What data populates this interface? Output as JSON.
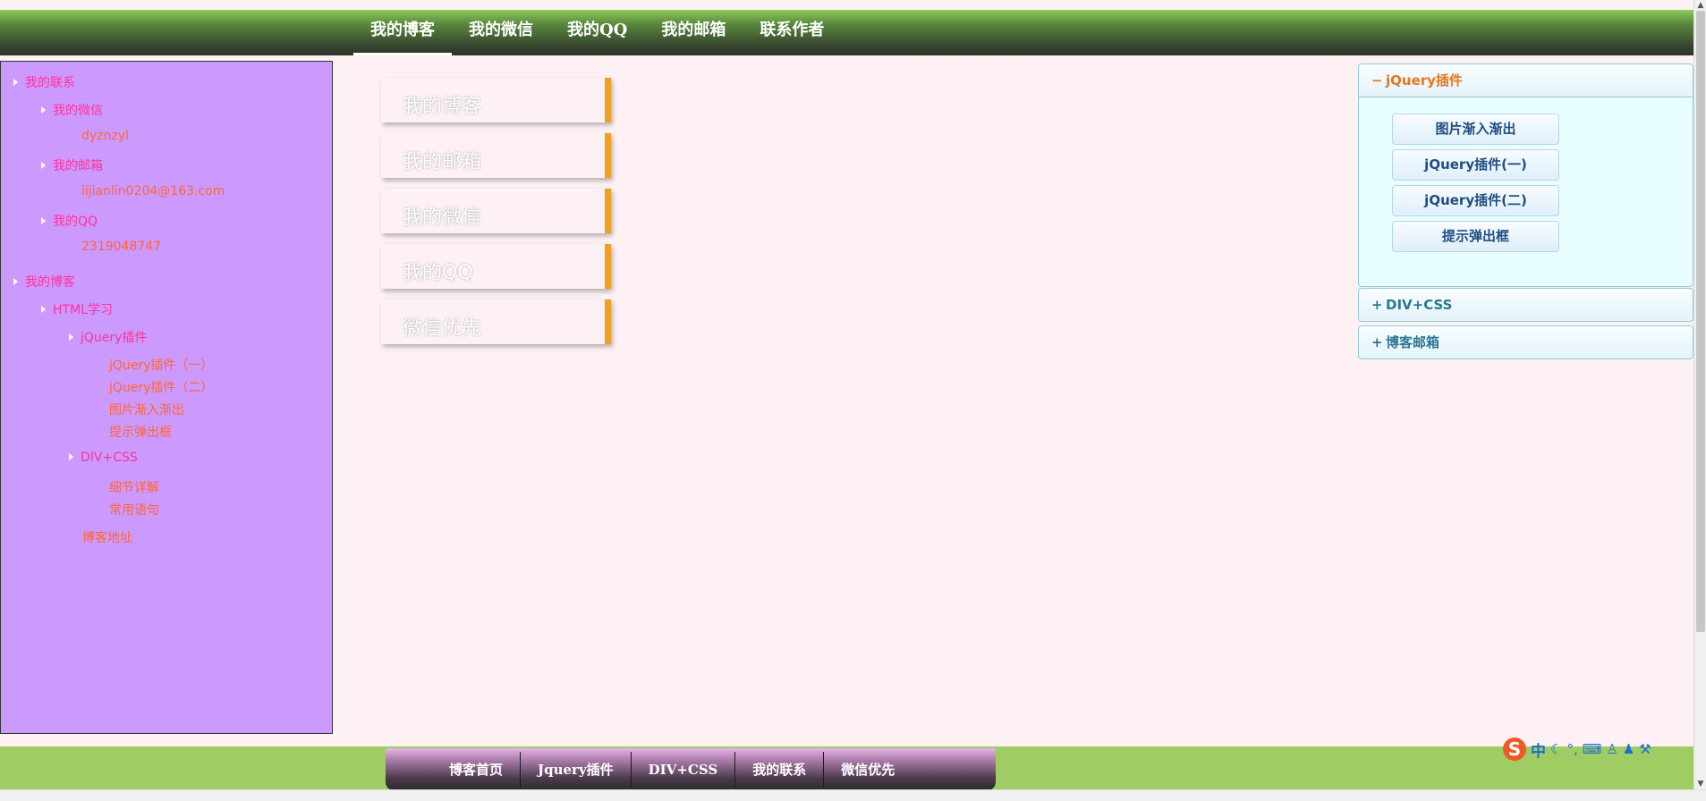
{
  "top_nav": {
    "items": [
      "我的博客",
      "我的微信",
      "我的QQ",
      "我的邮箱",
      "联系作者"
    ]
  },
  "left_tree": {
    "contact": "我的联系",
    "wechat": "我的微信",
    "wechat_value": "dyznzyl",
    "email": "我的邮箱",
    "email_value": "lijianlin0204@163.com",
    "qq": "我的QQ",
    "qq_value": "2319048747",
    "blog": "我的博客",
    "html": "HTML学习",
    "jquery": "jQuery插件",
    "jquery_one": "jQuery插件（一）",
    "jquery_two": "jQuery插件（二）",
    "fade": "图片渐入渐出",
    "popup": "提示弹出框",
    "divcss": "DIV+CSS",
    "detail": "细节详解",
    "common": "常用语句",
    "blog_addr": "博客地址"
  },
  "tiles": [
    "我的博客",
    "我的邮箱",
    "我的微信",
    "我的QQ",
    "微信优先"
  ],
  "accordion": {
    "open_sign": "−",
    "closed_sign": "+",
    "jquery_title": "jQuery插件",
    "buttons": [
      "图片渐入渐出",
      "jQuery插件(一)",
      "jQuery插件(二)",
      "提示弹出框"
    ],
    "divcss_title": "DIV+CSS",
    "mail_title": "博客邮箱"
  },
  "footer_nav": {
    "items": [
      "博客首页",
      "Jquery插件",
      "DIV+CSS",
      "我的联系",
      "微信优先"
    ]
  },
  "ime": {
    "logo": "S",
    "mode": "中"
  },
  "colors": {
    "top_bar": "#5a8a3c",
    "left_panel": "#cc99ff",
    "page_bg": "#fdf1f3",
    "tile_accent": "#f0a020",
    "footer_bg": "#9fcd63",
    "accordion_open_title": "#e6761a"
  },
  "icons": [
    "triangle-right-icon",
    "minus-icon",
    "plus-icon",
    "ime-logo-icon",
    "moon-icon",
    "keyboard-icon",
    "shirt-icon",
    "wrench-icon"
  ]
}
